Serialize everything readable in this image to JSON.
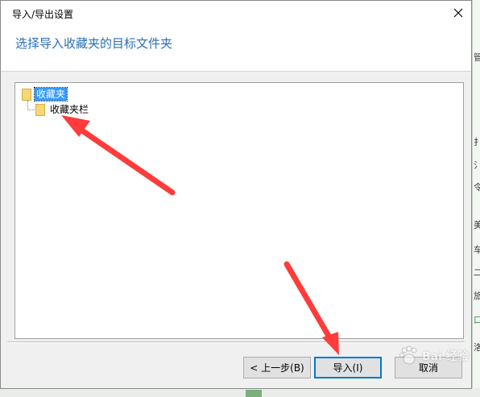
{
  "window": {
    "title": "导入/导出设置"
  },
  "header": {
    "title": "选择导入收藏夹的目标文件夹"
  },
  "tree": {
    "root": {
      "label": "收藏夹",
      "icon": "folder-icon",
      "selected": true
    },
    "children": [
      {
        "label": "收藏夹栏",
        "icon": "folder-icon"
      }
    ]
  },
  "buttons": {
    "back": "< 上一步(B)",
    "import": "导入(I)",
    "cancel": "取消"
  },
  "background_app": {
    "right_edge_glyphs": [
      "管",
      "扌",
      "氵",
      "令",
      "美",
      "车",
      "二",
      "旅",
      "口",
      "洛"
    ]
  },
  "watermark": {
    "text": "Bai 经验"
  },
  "colors": {
    "accent": "#2b6fb3",
    "selection": "#3399ff",
    "annotation": "#ff3b3b",
    "focus_border": "#0078d7"
  }
}
